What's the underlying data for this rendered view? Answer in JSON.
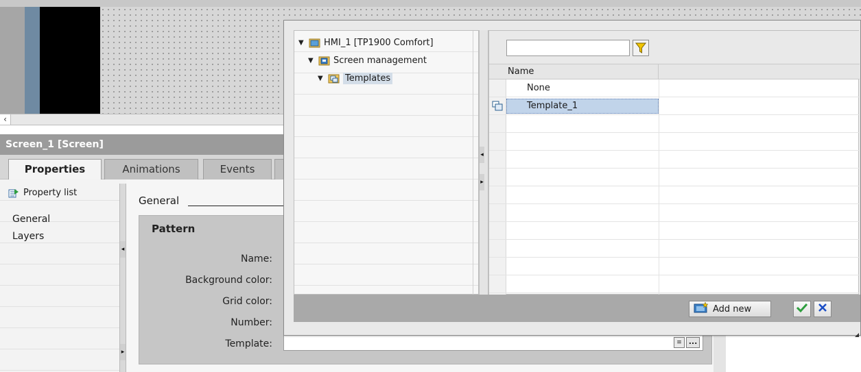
{
  "canvas": {
    "scroll_left_glyph": "‹"
  },
  "inspector": {
    "title": "Screen_1 [Screen]",
    "tabs": [
      {
        "label": "Properties",
        "active": true
      },
      {
        "label": "Animations",
        "active": false
      },
      {
        "label": "Events",
        "active": false
      }
    ],
    "nav": {
      "header": "Property list",
      "header_icon": "property-list-icon",
      "items": [
        "General",
        "Layers"
      ],
      "selected": "General"
    },
    "section": {
      "heading": "General",
      "group_title": "Pattern",
      "fields": [
        {
          "label": "Name:"
        },
        {
          "label": "Background color:"
        },
        {
          "label": "Grid color:"
        },
        {
          "label": "Number:"
        },
        {
          "label": "Template:",
          "value": ""
        }
      ],
      "template_dots_label": "..."
    }
  },
  "popup": {
    "tree": [
      {
        "label": "HMI_1 [TP1900 Comfort]",
        "icon": "hmi-device-icon",
        "expanded": true
      },
      {
        "label": "Screen management",
        "icon": "screen-management-icon",
        "expanded": true
      },
      {
        "label": "Templates",
        "icon": "templates-folder-icon",
        "expanded": true,
        "selected": true
      }
    ],
    "filter": {
      "value": "",
      "icon": "filter-funnel-icon"
    },
    "list": {
      "column_header": "Name",
      "rows": [
        {
          "name": "None",
          "icon": ""
        },
        {
          "name": "Template_1",
          "icon": "template-icon",
          "selected": true
        }
      ]
    },
    "footer": {
      "add_new_label": "Add new",
      "add_new_icon": "add-new-icon",
      "ok_icon": "checkmark-icon",
      "cancel_icon": "close-icon"
    }
  },
  "colors": {
    "selection_highlight": "#c1d4ea",
    "tree_selection": "#d3dde8",
    "ok_green": "#2e9e3e",
    "cancel_blue": "#1c4fc6",
    "funnel_yellow": "#f2c500"
  }
}
